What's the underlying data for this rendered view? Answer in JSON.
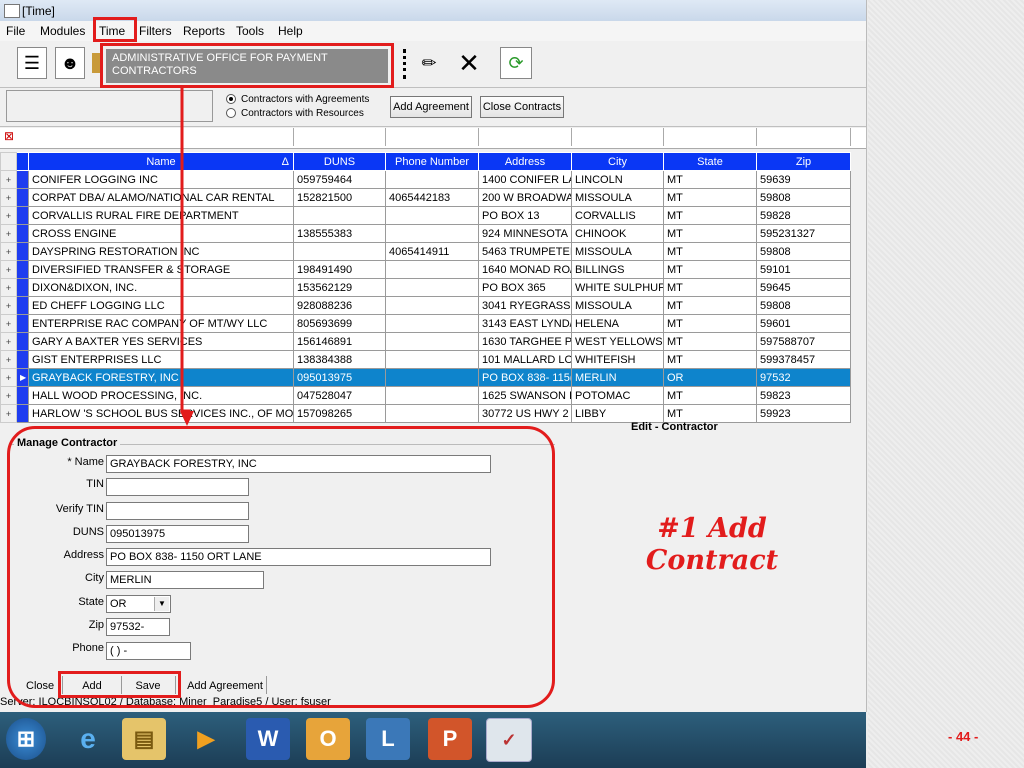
{
  "window": {
    "title": "[Time]"
  },
  "menu": [
    "File",
    "Modules",
    "Time",
    "Filters",
    "Reports",
    "Tools",
    "Help"
  ],
  "tooltip": "ADMINISTRATIVE OFFICE FOR PAYMENT CONTRACTORS",
  "filters": {
    "radio1": "Contractors with Agreements",
    "radio2": "Contractors with Resources",
    "add_agreement": "Add Agreement",
    "close_contracts": "Close Contracts"
  },
  "grid": {
    "headers": [
      "Name",
      "DUNS",
      "Phone Number",
      "Address",
      "City",
      "State",
      "Zip"
    ],
    "sort_glyph": "Δ",
    "rows": [
      [
        "CONIFER LOGGING INC",
        "059759464",
        "",
        "1400 CONIFER LA",
        "LINCOLN",
        "MT",
        "59639"
      ],
      [
        "CORPAT DBA/ ALAMO/NATIONAL CAR RENTAL",
        "152821500",
        "4065442183",
        "200 W BROADWA",
        "MISSOULA",
        "MT",
        "59808"
      ],
      [
        "CORVALLIS RURAL FIRE DEPARTMENT",
        "",
        "",
        "PO BOX 13",
        "CORVALLIS",
        "MT",
        "59828"
      ],
      [
        "CROSS ENGINE",
        "138555383",
        "",
        "924 MINNESOTA",
        "CHINOOK",
        "MT",
        "595231327"
      ],
      [
        "DAYSPRING RESTORATION INC",
        "",
        "4065414911",
        "5463 TRUMPETEI",
        "MISSOULA",
        "MT",
        "59808"
      ],
      [
        "DIVERSIFIED TRANSFER & STORAGE",
        "198491490",
        "",
        "1640 MONAD RO/",
        "BILLINGS",
        "MT",
        "59101"
      ],
      [
        "DIXON&DIXON, INC.",
        "153562129",
        "",
        "PO BOX 365",
        "WHITE SULPHUF",
        "MT",
        "59645"
      ],
      [
        "ED CHEFF LOGGING LLC",
        "928088236",
        "",
        "3041 RYEGRASS",
        "MISSOULA",
        "MT",
        "59808"
      ],
      [
        "ENTERPRISE RAC COMPANY OF MT/WY LLC",
        "805693699",
        "",
        "3143 EAST LYND/",
        "HELENA",
        "MT",
        "59601"
      ],
      [
        "GARY A BAXTER  YES SERVICES",
        "156146891",
        "",
        "1630 TARGHEE P",
        "WEST YELLOWS'",
        "MT",
        "597588707"
      ],
      [
        "GIST ENTERPRISES LLC",
        "138384388",
        "",
        "101 MALLARD LO",
        "WHITEFISH",
        "MT",
        "599378457"
      ],
      [
        "GRAYBACK FORESTRY, INC",
        "095013975",
        "",
        "PO BOX 838- 115(",
        "MERLIN",
        "OR",
        "97532"
      ],
      [
        "HALL WOOD PROCESSING, INC.",
        "047528047",
        "",
        "1625 SWANSON I",
        "POTOMAC",
        "MT",
        "59823"
      ],
      [
        "HARLOW 'S SCHOOL BUS SERVICES INC., OF MO",
        "157098265",
        "",
        "30772 US HWY 2",
        "LIBBY",
        "MT",
        "59923"
      ]
    ]
  },
  "edit_title": "Edit - Contractor",
  "form": {
    "title": "Manage Contractor",
    "name_label": "* Name",
    "name_value": "GRAYBACK FORESTRY, INC",
    "tin_label": "TIN",
    "tin_value": "",
    "verify_label": "Verify TIN",
    "verify_value": "",
    "duns_label": "DUNS",
    "duns_value": "095013975",
    "address_label": "Address",
    "address_value": "PO BOX 838- 1150 ORT LANE",
    "city_label": "City",
    "city_value": "MERLIN",
    "state_label": "State",
    "state_value": "OR",
    "zip_label": "Zip",
    "zip_value": "97532-",
    "phone_label": "Phone",
    "phone_value": "(  )   -"
  },
  "buttons": {
    "close": "Close",
    "add": "Add",
    "save": "Save",
    "add_agreement": "Add Agreement"
  },
  "status": "Server: ILOCBINSQL02 / Database: Miner_Paradise5 / User: fsuser",
  "annotation": {
    "line1": "#1 Add",
    "line2": "Contract"
  },
  "page_number": "- 44 -",
  "colors": {
    "accent_red": "#e21c1c",
    "header_blue": "#0a37f5",
    "selected_row": "#0e84cc"
  }
}
